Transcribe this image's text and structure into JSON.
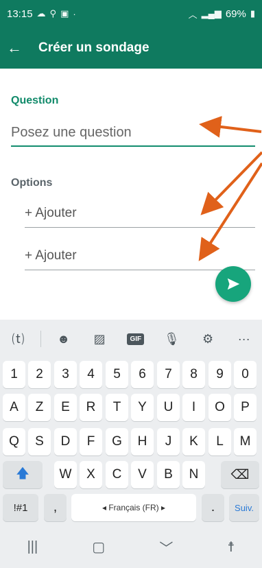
{
  "status": {
    "time": "13:15",
    "battery": "69%"
  },
  "appbar": {
    "title": "Créer un sondage"
  },
  "form": {
    "question_label": "Question",
    "question_placeholder": "Posez une question",
    "options_label": "Options",
    "option1_placeholder": "+ Ajouter",
    "option2_placeholder": "+ Ajouter"
  },
  "icons": {
    "accent": "#0f7a5f",
    "fab": "#17a57c",
    "annotation_arrow": "#e0611a"
  },
  "keyboard": {
    "toolbar": [
      "translate-icon",
      "emoji-icon",
      "sticker-icon",
      "gif-icon",
      "mic-icon",
      "settings-icon",
      "more-icon"
    ],
    "gif_label": "GIF",
    "more_label": "···",
    "row_numbers": [
      "1",
      "2",
      "3",
      "4",
      "5",
      "6",
      "7",
      "8",
      "9",
      "0"
    ],
    "row_azerty1": [
      "A",
      "Z",
      "E",
      "R",
      "T",
      "Y",
      "U",
      "I",
      "O",
      "P"
    ],
    "row_azerty2": [
      "Q",
      "S",
      "D",
      "F",
      "G",
      "H",
      "J",
      "K",
      "L",
      "M"
    ],
    "row_azerty3": [
      "W",
      "X",
      "C",
      "V",
      "B",
      "N"
    ],
    "symbols_key": "!#1",
    "comma_key": ",",
    "space_label": "◂ Français (FR) ▸",
    "period_key": ".",
    "next_key": "Suiv."
  }
}
